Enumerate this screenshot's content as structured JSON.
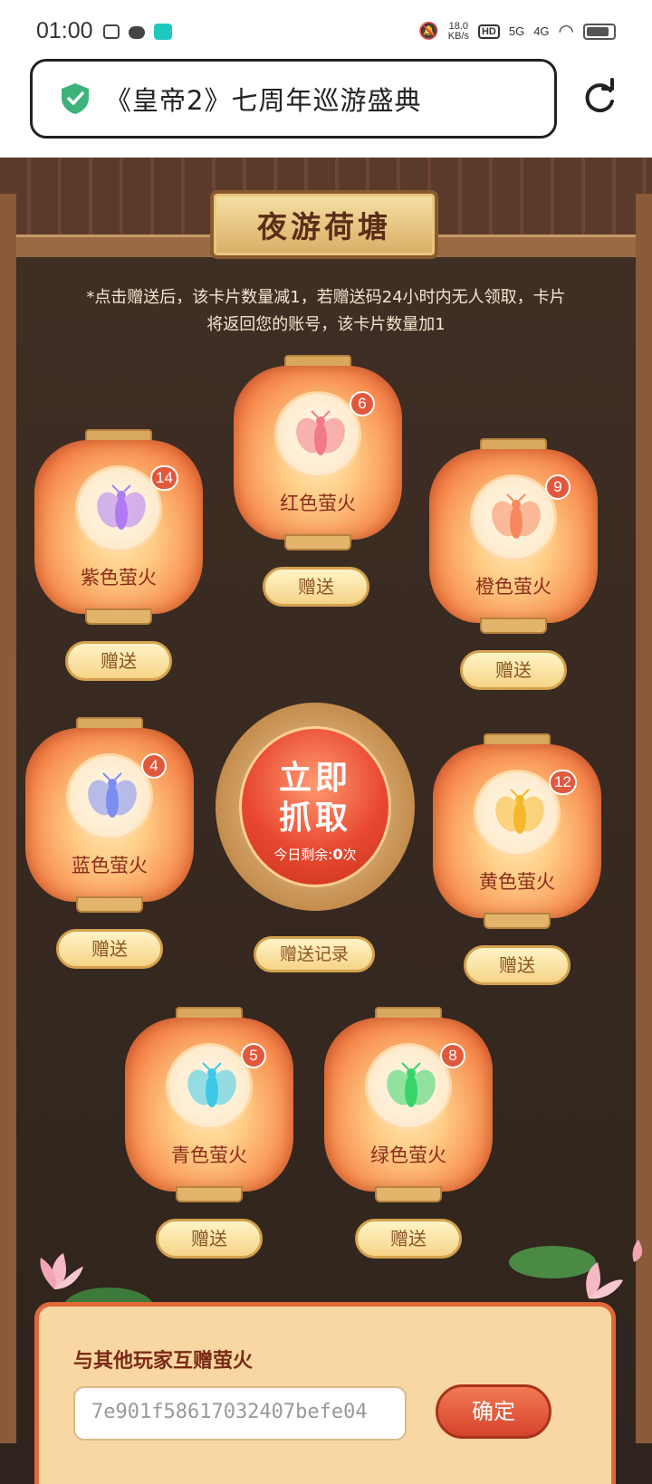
{
  "status_bar": {
    "time": "01:00",
    "speed_value": "18.0",
    "speed_unit": "KB/s",
    "hd_label": "HD",
    "signal1": "5G",
    "signal2": "4G"
  },
  "browser": {
    "page_title": "《皇帝2》七周年巡游盛典",
    "secure_color": "#3db37b"
  },
  "game": {
    "title": "夜游荷塘",
    "notice": "*点击赠送后，该卡片数量减1，若赠送码24小时内无人领取，卡片将返回您的账号，该卡片数量加1",
    "gift_label": "赠送",
    "lanterns": [
      {
        "label": "红色萤火",
        "count": "6",
        "fly_color": "#f27a85"
      },
      {
        "label": "紫色萤火",
        "count": "14",
        "fly_color": "#b07af2"
      },
      {
        "label": "橙色萤火",
        "count": "9",
        "fly_color": "#f7885e"
      },
      {
        "label": "蓝色萤火",
        "count": "4",
        "fly_color": "#7c8cf0"
      },
      {
        "label": "黄色萤火",
        "count": "12",
        "fly_color": "#f5b82c"
      },
      {
        "label": "青色萤火",
        "count": "5",
        "fly_color": "#3cc8e6"
      },
      {
        "label": "绿色萤火",
        "count": "8",
        "fly_color": "#37d46a"
      }
    ],
    "catch": {
      "title_line1": "立即",
      "title_line2": "抓取",
      "remain_prefix": "今日剩余:",
      "remain_count": "0",
      "remain_suffix": "次"
    },
    "record_label": "赠送记录",
    "exchange": {
      "title": "与其他玩家互赠萤火",
      "code_value": "7e901f58617032407befe04",
      "confirm_label": "确定"
    }
  }
}
